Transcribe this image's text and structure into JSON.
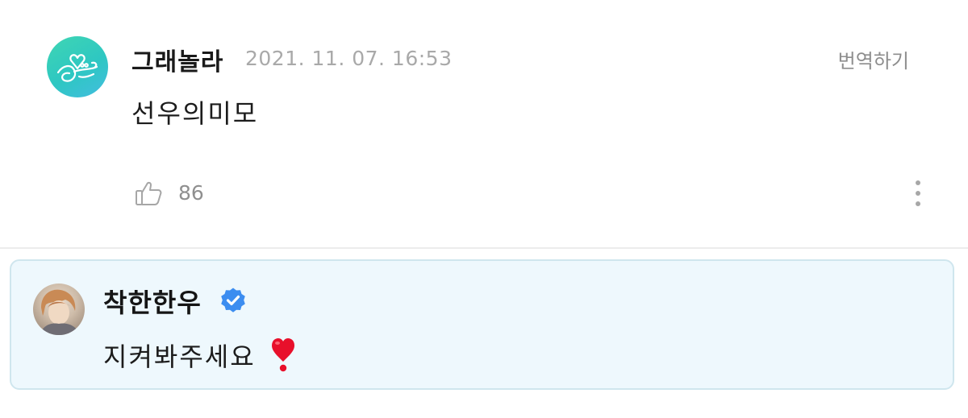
{
  "fan_comment": {
    "author": "그래놀라",
    "timestamp": "2021. 11. 07. 16:53",
    "translate_label": "번역하기",
    "text": "선우의미모",
    "like_count": "86",
    "avatar_icon": "heart-sketch-avatar",
    "like_icon": "thumbs-up-icon",
    "more_icon": "more-vertical-icon"
  },
  "artist_reply": {
    "author": "착한한우",
    "verified_icon": "verified-badge-icon",
    "text": "지켜봐주세요",
    "emoji": "red-heart-exclamation-emoji"
  },
  "colors": {
    "reply_background": "#eef8fd",
    "reply_border": "#cfe6ee",
    "verified_badge": "#3c8df0",
    "fan_avatar_gradient": [
      "#3fd6b3",
      "#43bde0"
    ],
    "heart_emoji": "#e8102b"
  }
}
